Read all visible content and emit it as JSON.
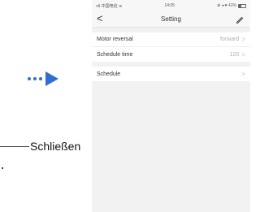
{
  "annotation": {
    "callout_label": "Schließen"
  },
  "status_bar": {
    "carrier": "•ıll 中国电信 ≋",
    "time": "14:05",
    "indicators": "⊕ ◂ ♥ 41%"
  },
  "header": {
    "back_glyph": "<",
    "title": "Setting"
  },
  "settings": {
    "motor_reversal": {
      "label": "Motor reversal",
      "value": "forward",
      "chevron": ">"
    },
    "schedule_time": {
      "label": "Schedule time",
      "value": "120",
      "chevron": ">"
    },
    "schedule": {
      "label": "Schedule",
      "value": "",
      "chevron": ">"
    }
  }
}
